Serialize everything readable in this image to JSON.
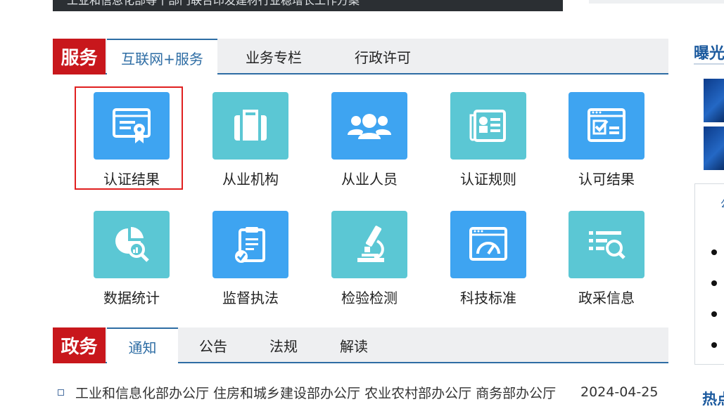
{
  "top_banner": {
    "text": "工业和信息化部等十部门联合印发建材行业稳增长工作方案"
  },
  "service": {
    "label": "服务",
    "tabs": [
      "互联网+服务",
      "业务专栏",
      "行政许可"
    ],
    "items": [
      {
        "label": "认证结果",
        "icon": "certificate-icon",
        "color": "#3ea4f1"
      },
      {
        "label": "从业机构",
        "icon": "briefcase-icon",
        "color": "#5bc7d4"
      },
      {
        "label": "从业人员",
        "icon": "people-group-icon",
        "color": "#3ea4f1"
      },
      {
        "label": "认证规则",
        "icon": "rules-document-icon",
        "color": "#5bc7d4"
      },
      {
        "label": "认可结果",
        "icon": "approval-window-icon",
        "color": "#3ea4f1"
      },
      {
        "label": "数据统计",
        "icon": "data-search-icon",
        "color": "#5bc7d4"
      },
      {
        "label": "监督执法",
        "icon": "clipboard-check-icon",
        "color": "#3ea4f1"
      },
      {
        "label": "检验检测",
        "icon": "microscope-icon",
        "color": "#5bc7d4"
      },
      {
        "label": "科技标准",
        "icon": "gauge-window-icon",
        "color": "#3ea4f1"
      },
      {
        "label": "政采信息",
        "icon": "list-search-icon",
        "color": "#5bc7d4"
      }
    ]
  },
  "gov": {
    "label": "政务",
    "tabs": [
      "通知",
      "公告",
      "法规",
      "解读"
    ]
  },
  "news": [
    {
      "title": "工业和信息化部办公厅 住房和城乡建设部办公厅 农业农村部办公厅 商务部办公厅",
      "date": "2024-04-25"
    }
  ],
  "right": {
    "heading": "曝光",
    "box_text": "公",
    "heading2": "热点"
  },
  "colors": {
    "brand_red": "#c8171c",
    "accent_blue": "#2e6da4",
    "tile_blue": "#3ea4f1",
    "tile_teal": "#5bc7d4"
  }
}
